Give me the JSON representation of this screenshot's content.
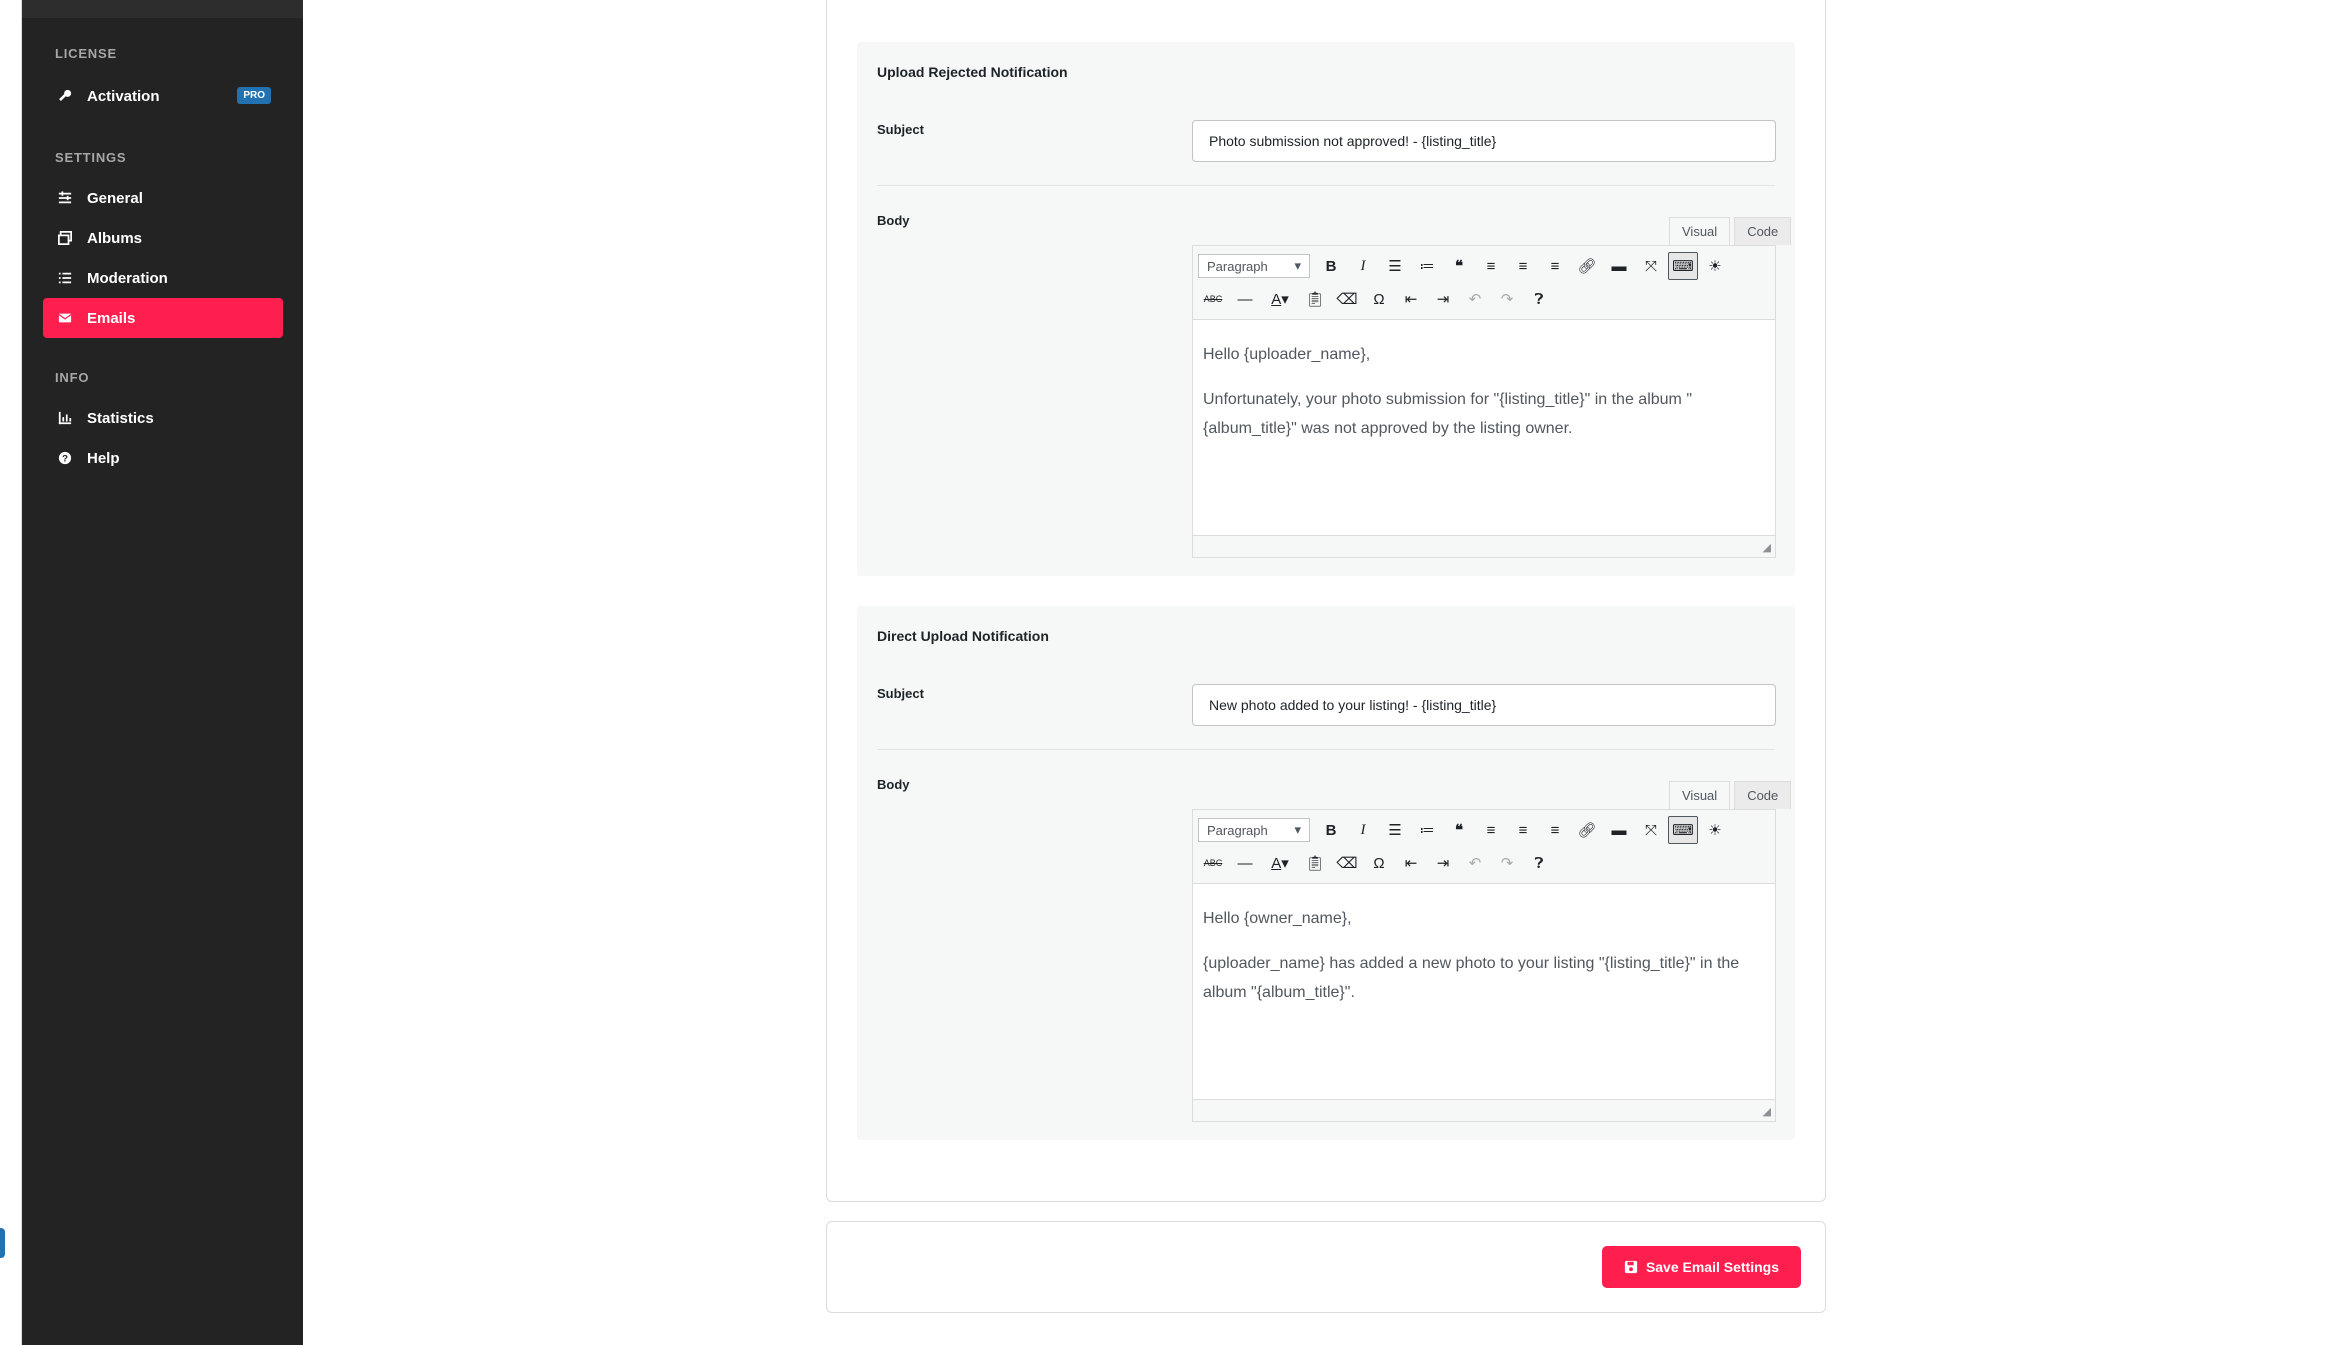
{
  "sidebar": {
    "sections": [
      {
        "label": "LICENSE"
      },
      {
        "label": "SETTINGS"
      },
      {
        "label": "INFO"
      }
    ],
    "license_items": [
      {
        "label": "Activation",
        "icon": "key-icon",
        "badge": "PRO"
      }
    ],
    "settings_items": [
      {
        "label": "General",
        "icon": "sliders-icon"
      },
      {
        "label": "Albums",
        "icon": "images-icon"
      },
      {
        "label": "Moderation",
        "icon": "list-check-icon"
      },
      {
        "label": "Emails",
        "icon": "envelope-icon",
        "active": true
      }
    ],
    "info_items": [
      {
        "label": "Statistics",
        "icon": "chart-icon"
      },
      {
        "label": "Help",
        "icon": "help-icon"
      }
    ],
    "active_color": "#ff1f4f",
    "background_color": "#232323"
  },
  "sections": [
    {
      "title": "Upload Rejected Notification",
      "subject_label": "Subject",
      "subject_value": "Photo submission not approved! - {listing_title}",
      "body_label": "Body",
      "tabs": {
        "visual": "Visual",
        "code": "Code"
      },
      "format": "Paragraph",
      "paragraphs": [
        "Hello {uploader_name},",
        "Unfortunately, your photo submission for \"{listing_title}\" in the album \"{album_title}\" was not approved by the listing owner."
      ]
    },
    {
      "title": "Direct Upload Notification",
      "subject_label": "Subject",
      "subject_value": "New photo added to your listing! - {listing_title}",
      "body_label": "Body",
      "tabs": {
        "visual": "Visual",
        "code": "Code"
      },
      "format": "Paragraph",
      "paragraphs": [
        "Hello {owner_name},",
        "{uploader_name} has added a new photo to your listing \"{listing_title}\" in the album \"{album_title}\"."
      ]
    }
  ],
  "toolbar": {
    "row1": [
      "bold-icon",
      "italic-icon",
      "bullet-list-icon",
      "numbered-list-icon",
      "blockquote-icon",
      "align-left-icon",
      "align-center-icon",
      "align-right-icon",
      "link-icon",
      "read-more-icon",
      "fullscreen-icon",
      "toolbar-toggle-icon",
      "sun-icon"
    ],
    "row2": [
      "strikethrough-icon",
      "horizontal-line-icon",
      "text-color-icon",
      "paste-text-icon",
      "clear-formatting-icon",
      "special-character-icon",
      "outdent-icon",
      "indent-icon",
      "undo-icon",
      "redo-icon",
      "help-icon"
    ]
  },
  "footer": {
    "save_label": "Save Email Settings",
    "save_color": "#ff1f4f"
  }
}
